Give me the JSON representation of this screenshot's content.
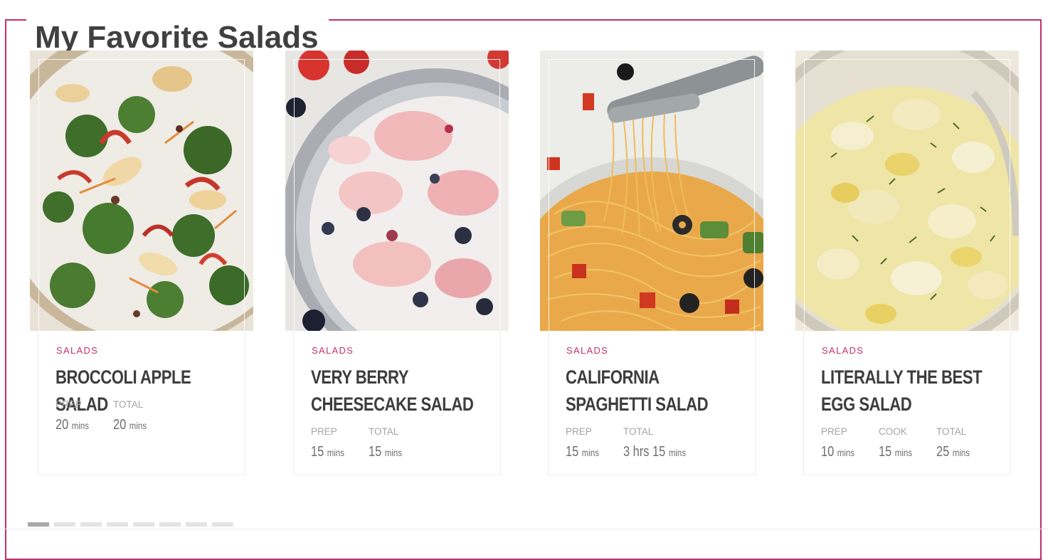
{
  "section": {
    "title": "My Favorite Salads"
  },
  "accent_color": "#c2306c",
  "cards": [
    {
      "image_alt": "broccoli apple salad photo",
      "category": "SALADS",
      "title": "BROCCOLI APPLE SALAD",
      "times": [
        {
          "label": "PREP",
          "value": "20",
          "unit": "mins"
        },
        {
          "label": "TOTAL",
          "value": "20",
          "unit": "mins"
        }
      ]
    },
    {
      "image_alt": "very berry cheesecake salad photo",
      "category": "SALADS",
      "title": "VERY BERRY CHEESECAKE SALAD",
      "times": [
        {
          "label": "PREP",
          "value": "15",
          "unit": "mins"
        },
        {
          "label": "TOTAL",
          "value": "15",
          "unit": "mins"
        }
      ]
    },
    {
      "image_alt": "california spaghetti salad photo",
      "category": "SALADS",
      "title": "CALIFORNIA SPAGHETTI SALAD",
      "times": [
        {
          "label": "PREP",
          "value": "15",
          "unit": "mins"
        },
        {
          "label": "TOTAL",
          "value": "3 hrs 15",
          "unit": "mins"
        }
      ]
    },
    {
      "image_alt": "egg salad photo",
      "category": "SALADS",
      "title": "LITERALLY THE BEST EGG SALAD",
      "times": [
        {
          "label": "PREP",
          "value": "10",
          "unit": "mins"
        },
        {
          "label": "COOK",
          "value": "15",
          "unit": "mins"
        },
        {
          "label": "TOTAL",
          "value": "25",
          "unit": "mins"
        }
      ]
    }
  ],
  "pagination": {
    "total": 8,
    "active_index": 0
  }
}
